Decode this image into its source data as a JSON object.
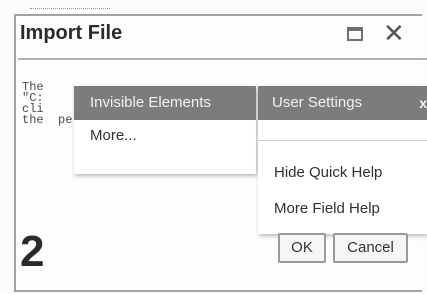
{
  "dialog": {
    "title": "Import File",
    "body_text": "The\n\"C:\ncli\nthe  perse  file.",
    "step_number": "2"
  },
  "menu_left": {
    "header": "Invisible Elements",
    "items": [
      "More..."
    ]
  },
  "menu_right": {
    "header": "User Settings",
    "header_close": "x",
    "items": [
      "Hide Quick Help",
      "More Field Help"
    ]
  },
  "buttons": {
    "ok": "OK",
    "cancel": "Cancel"
  },
  "icons": {
    "maximize": "maximize-icon",
    "close": "close-icon"
  },
  "colors": {
    "menu_header_bg": "#7c7c7c",
    "menu_header_text": "#f2f2f2"
  }
}
